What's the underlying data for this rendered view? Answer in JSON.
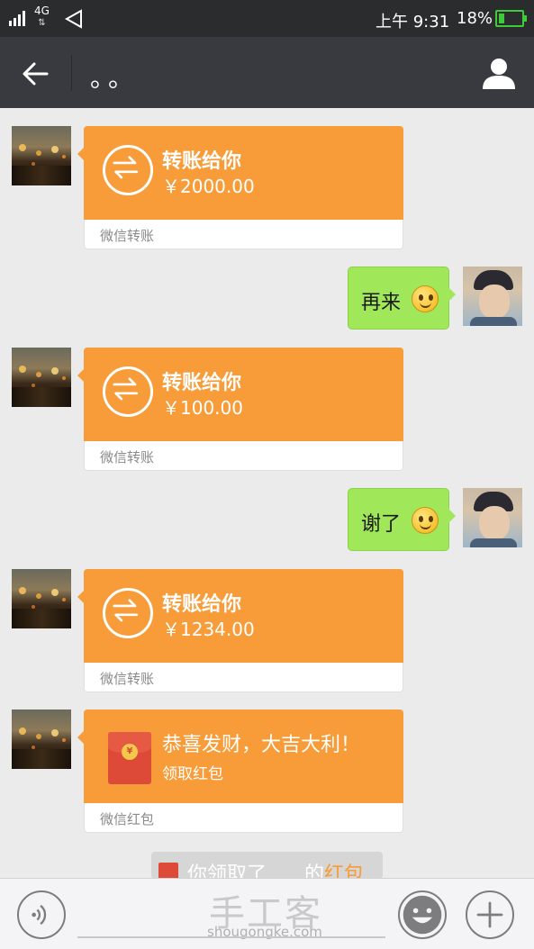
{
  "status_bar": {
    "network": "4G",
    "time": "上午 9:31",
    "battery": "18%",
    "battery_level": 0.18
  },
  "header": {
    "title": "。。"
  },
  "messages": [
    {
      "kind": "transfer",
      "title": "转账给你",
      "amount": "￥2000.00",
      "footer": "微信转账"
    },
    {
      "kind": "sent",
      "text": "再来"
    },
    {
      "kind": "transfer",
      "title": "转账给你",
      "amount": "￥100.00",
      "footer": "微信转账"
    },
    {
      "kind": "sent",
      "text": "谢了"
    },
    {
      "kind": "transfer",
      "title": "转账给你",
      "amount": "￥1234.00",
      "footer": "微信转账"
    },
    {
      "kind": "red_packet",
      "title": "恭喜发财，大吉大利！",
      "action": "领取红包",
      "footer": "微信红包",
      "coin": "¥"
    }
  ],
  "system_notice": {
    "text_prefix": "你领取了",
    "text_middle": "的",
    "link": "红包"
  },
  "watermark": {
    "logo": "手工客",
    "site": "shougongke.com"
  }
}
